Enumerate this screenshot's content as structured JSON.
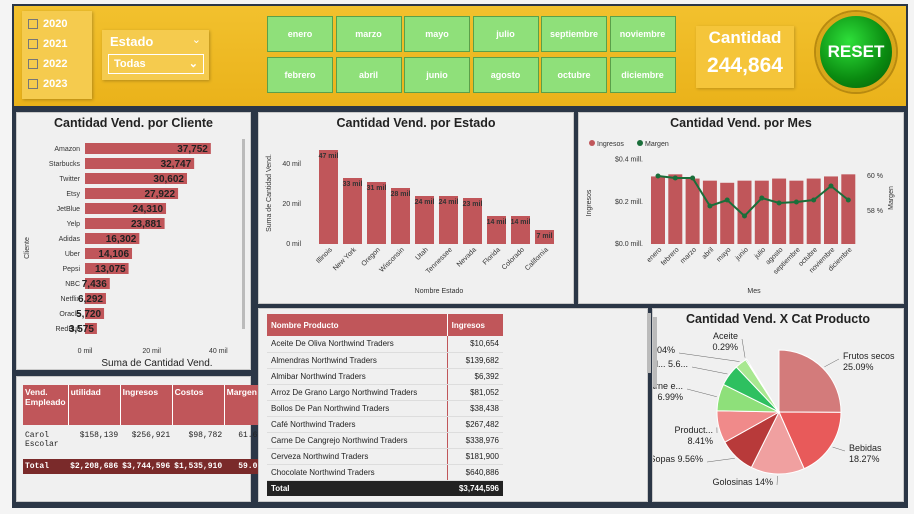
{
  "filters": {
    "years": [
      "2020",
      "2021",
      "2022",
      "2023"
    ],
    "estado_label": "Estado",
    "estado_value": "Todas",
    "months_row1": [
      "enero",
      "marzo",
      "mayo",
      "julio",
      "septiembre",
      "noviembre"
    ],
    "months_row2": [
      "febrero",
      "abril",
      "junio",
      "agosto",
      "octubre",
      "diciembre"
    ]
  },
  "kpi": {
    "label": "Cantidad",
    "value": "244,864"
  },
  "reset_label": "RESET",
  "colors": {
    "bar": "#c0565a",
    "header": "#c0565a",
    "line": "#1a6e3a",
    "gold": "#f2c12e"
  },
  "cliente": {
    "title": "Cantidad Vend. por Cliente",
    "ylabel": "Cliente",
    "xlabel": "Suma de Cantidad Vend.",
    "ticks": [
      "0 mil",
      "20 mil",
      "40 mil"
    ],
    "rows": [
      {
        "n": "Amazon",
        "v": 37752,
        "t": "37,752"
      },
      {
        "n": "Starbucks",
        "v": 32747,
        "t": "32,747"
      },
      {
        "n": "Twitter",
        "v": 30602,
        "t": "30,602"
      },
      {
        "n": "Etsy",
        "v": 27922,
        "t": "27,922"
      },
      {
        "n": "JetBlue",
        "v": 24310,
        "t": "24,310"
      },
      {
        "n": "Yelp",
        "v": 23881,
        "t": "23,881"
      },
      {
        "n": "Adidas",
        "v": 16302,
        "t": "16,302"
      },
      {
        "n": "Uber",
        "v": 14106,
        "t": "14,106"
      },
      {
        "n": "Pepsi",
        "v": 13075,
        "t": "13,075"
      },
      {
        "n": "NBC",
        "v": 7436,
        "t": "7,436"
      },
      {
        "n": "Netflix",
        "v": 6292,
        "t": "6,292"
      },
      {
        "n": "Oracle",
        "v": 5720,
        "t": "5,720"
      },
      {
        "n": "RedBull",
        "v": 3575,
        "t": "3,575"
      }
    ]
  },
  "estado": {
    "title": "Cantidad Vend. por Estado",
    "ylabel": "Suma de Cantidad Vend.",
    "xlabel": "Nombre Estado",
    "ticks": [
      "0 mil",
      "20 mil",
      "40 mil"
    ],
    "cats": [
      "Illinois",
      "New York",
      "Oregon",
      "Wisconsin",
      "Utah",
      "Tennessee",
      "Nevada",
      "Florida",
      "Colorado",
      "California"
    ],
    "values": [
      47,
      33,
      31,
      28,
      24,
      24,
      23,
      14,
      14,
      7
    ],
    "labels": [
      "47 mil",
      "33 mil",
      "31 mil",
      "28 mil",
      "24 mil",
      "24 mil",
      "23 mil",
      "14 mil",
      "14 mil",
      "7 mil"
    ]
  },
  "mes": {
    "title": "Cantidad Vend. por Mes",
    "legend": [
      "Ingresos",
      "Margen"
    ],
    "yleft": "Ingresos",
    "yright": "Margen",
    "xlabel": "Mes",
    "lticks": [
      "$0.4 mill.",
      "$0.2 mill.",
      "$0.0 mill."
    ],
    "rticks": [
      "60 %",
      "58 %"
    ],
    "cats": [
      "enero",
      "febrero",
      "marzo",
      "abril",
      "mayo",
      "junio",
      "julio",
      "agosto",
      "septiembre",
      "octubre",
      "noviembre",
      "diciembre"
    ],
    "ingresos": [
      0.32,
      0.33,
      0.31,
      0.3,
      0.29,
      0.3,
      0.3,
      0.31,
      0.3,
      0.31,
      0.32,
      0.33
    ],
    "margen": [
      61.2,
      61.0,
      61.0,
      58.2,
      58.8,
      57.2,
      59.0,
      58.5,
      58.6,
      58.8,
      60.2,
      58.8
    ]
  },
  "emp": {
    "headers": [
      "Vend. Empleado",
      "utilidad",
      "Ingresos",
      "Costos",
      "Margen"
    ],
    "rows": [
      [
        "Carol Escolar",
        "$158,139",
        "$256,921",
        "$98,782",
        "61.6"
      ]
    ],
    "total": [
      "Total",
      "$2,208,686",
      "$3,744,596",
      "$1,535,910",
      "59.0"
    ]
  },
  "prod": {
    "headers": [
      "Nombre Producto",
      "Ingresos"
    ],
    "rows": [
      [
        "Aceite De Oliva Northwind Traders",
        "$10,654"
      ],
      [
        "Almendras Northwind Traders",
        "$139,682"
      ],
      [
        "Almibar Northwind Traders",
        "$6,392"
      ],
      [
        "Arroz De Grano Largo Northwind Traders",
        "$81,052"
      ],
      [
        "Bollos De Pan Northwind Traders",
        "$38,438"
      ],
      [
        "Café Northwind Traders",
        "$267,482"
      ],
      [
        "Carne De Cangrejo Northwind Traders",
        "$338,976"
      ],
      [
        "Cerveza Northwind Traders",
        "$181,900"
      ],
      [
        "Chocolate Northwind Traders",
        "$640,886"
      ]
    ],
    "total": [
      "Total",
      "$3,744,596"
    ]
  },
  "pie": {
    "title": "Cantidad Vend. X Cat Producto",
    "slices": [
      {
        "n": "Frutos secos",
        "v": 25.09,
        "t": "Frutos secos\n25.09%",
        "c": "#d37b7b"
      },
      {
        "n": "Bebidas",
        "v": 18.27,
        "t": "Bebidas\n18.27%",
        "c": "#e85a5a"
      },
      {
        "n": "Golosinas",
        "v": 14,
        "t": "Golosinas 14%",
        "c": "#f0a0a0"
      },
      {
        "n": "Sopas",
        "v": 9.56,
        "t": "Sopas 9.56%",
        "c": "#b83a3a"
      },
      {
        "n": "Product...",
        "v": 8.41,
        "t": "Product...\n8.41%",
        "c": "#f08a8a"
      },
      {
        "n": "Carne e...",
        "v": 6.99,
        "t": "Carne e...\n6.99%",
        "c": "#8ee07a"
      },
      {
        "n": "Prod...",
        "v": 5.6,
        "t": "Prod... 5.6...",
        "c": "#2ec060"
      },
      {
        "n": "Granos",
        "v": 3.04,
        "t": "Granos 3.04%",
        "c": "#a8e890"
      },
      {
        "n": "Aceite",
        "v": 0.29,
        "t": "Aceite\n0.29%",
        "c": "#1a8a3a"
      }
    ]
  }
}
